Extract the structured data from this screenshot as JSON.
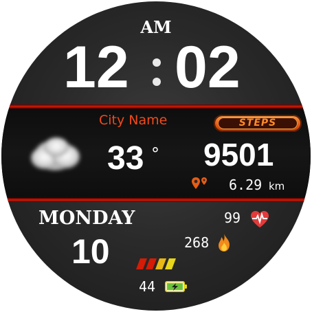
{
  "time": {
    "ampm": "AM",
    "hours": "12",
    "minutes": "02"
  },
  "weather": {
    "city": "City Name",
    "temperature": "33",
    "degree_symbol": "°",
    "icon": "cloud-icon"
  },
  "steps": {
    "label": "STEPS",
    "value": "9501"
  },
  "distance": {
    "value": "6.29",
    "unit": "km"
  },
  "date": {
    "day_name": "MONDAY",
    "day_number": "10"
  },
  "heart_rate": {
    "value": "99"
  },
  "calories": {
    "value": "268"
  },
  "battery": {
    "value": "44"
  },
  "colors": {
    "accent": "#d41c06",
    "city": "#f24a1a",
    "steps_badge": "#e85c12",
    "text": "#ffffff"
  },
  "icons": [
    "cloud-icon",
    "location-pins-icon",
    "heart-rate-icon",
    "flame-icon",
    "battery-charging-icon",
    "battery-level-bars-icon"
  ]
}
